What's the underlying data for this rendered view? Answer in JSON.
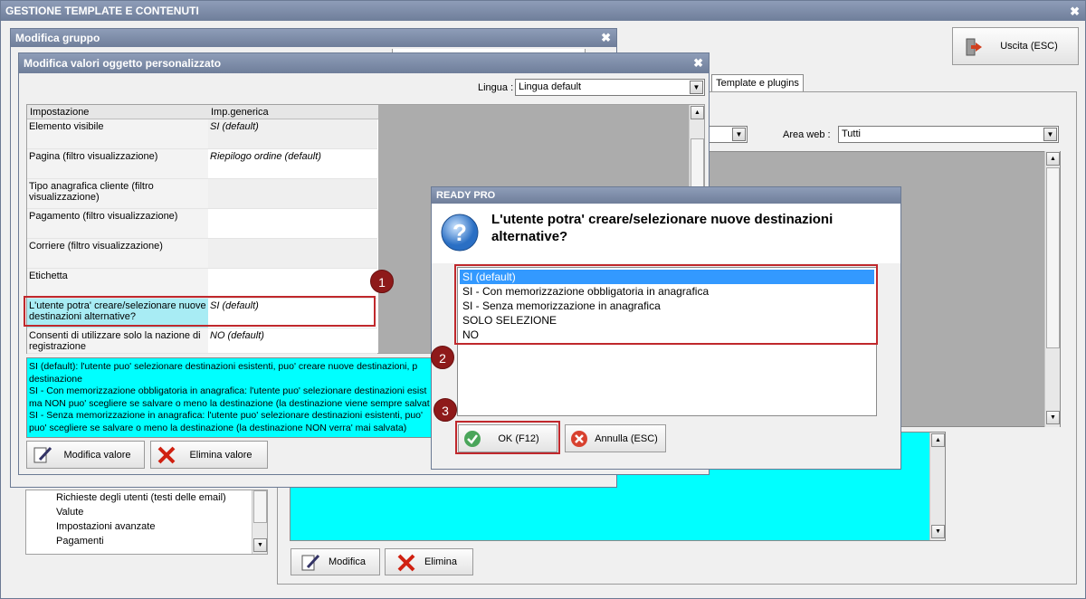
{
  "main_window": {
    "title": "GESTIONE TEMPLATE E CONTENUTI",
    "exit_button": "Uscita (ESC)",
    "tab_label": "Template e plugins",
    "area_web_label": "Area web :",
    "area_web_value": "Tutti",
    "modify_button": "Modifica",
    "delete_button": "Elimina",
    "tree_items": [
      "Richieste degli utenti (testi delle email)",
      "Valute",
      "Impostazioni avanzate",
      "Pagamenti"
    ]
  },
  "group_window": {
    "title": "Modifica gruppo"
  },
  "custom_window": {
    "title": "Modifica valori oggetto personalizzato",
    "language_label": "Lingua :",
    "language_value": "Lingua default",
    "columns": [
      "Impostazione",
      "Imp.generica"
    ],
    "rows": [
      {
        "setting": "Elemento visibile",
        "value": "SI (default)"
      },
      {
        "setting": "Pagina (filtro visualizzazione)",
        "value": "Riepilogo ordine (default)"
      },
      {
        "setting": "Tipo anagrafica cliente (filtro visualizzazione)",
        "value": ""
      },
      {
        "setting": "Pagamento (filtro visualizzazione)",
        "value": ""
      },
      {
        "setting": "Corriere (filtro visualizzazione)",
        "value": ""
      },
      {
        "setting": "Etichetta",
        "value": ""
      },
      {
        "setting": "L'utente potra' creare/selezionare nuove destinazioni alternative?",
        "value": "SI (default)"
      },
      {
        "setting": "Consenti di utilizzare solo la nazione di registrazione",
        "value": "NO (default)"
      }
    ],
    "description_lines": [
      "SI (default): l'utente puo' selezionare destinazioni esistenti, puo' creare nuove destinazioni, p",
      "destinazione",
      "SI - Con memorizzazione obbligatoria in anagrafica: l'utente puo' selezionare destinazioni esist",
      "ma NON puo' scegliere se salvare o meno la destinazione (la destinazione viene sempre salvat",
      "SI - Senza memorizzazione in anagrafica: l'utente puo' selezionare destinazioni esistenti, puo'",
      "puo' scegliere se salvare o meno la destinazione (la destinazione NON verra' mai salvata)"
    ],
    "modify_value_button": "Modifica valore",
    "delete_value_button": "Elimina valore"
  },
  "dialog": {
    "title": "READY PRO",
    "question": "L'utente potra' creare/selezionare nuove destinazioni alternative?",
    "options": [
      "SI (default)",
      "SI - Con memorizzazione obbligatoria in anagrafica",
      "SI - Senza memorizzazione in anagrafica",
      "SOLO SELEZIONE",
      "NO"
    ],
    "selected_index": 0,
    "ok_button": "OK (F12)",
    "cancel_button": "Annulla (ESC)"
  },
  "badges": [
    "1",
    "2",
    "3"
  ],
  "colors": {
    "highlight": "#3399ff",
    "info_bg": "#00ffff",
    "annotation_red": "#c0282c",
    "badge": "#8e1a1a"
  }
}
